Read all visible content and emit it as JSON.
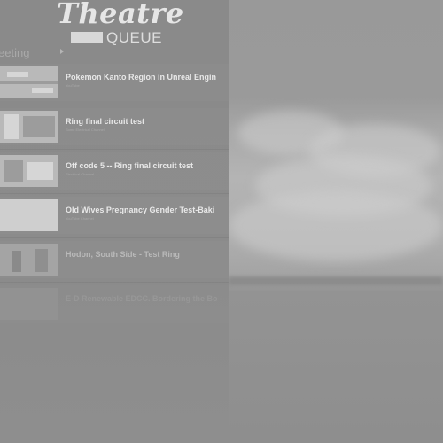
{
  "logo": {
    "script_text": "Theatre",
    "sub_text": "QUEUE"
  },
  "section": {
    "label": "eeting"
  },
  "queue": [
    {
      "title": "Pokemon Kanto Region in Unreal Engin",
      "subtitle": "YouTube"
    },
    {
      "title": "Ring final circuit test",
      "subtitle": "Some Electrical Channel"
    },
    {
      "title": "Off code 5 -- Ring final circuit test",
      "subtitle": "Electrical Channel"
    },
    {
      "title": "Old Wives Pregnancy Gender Test-Baki",
      "subtitle": "YouTube Channel"
    },
    {
      "title": "Hodon, South Side - Test Ring",
      "subtitle": ""
    },
    {
      "title": "E-D Renewable EDCC. Bordering the Bo",
      "subtitle": ""
    }
  ]
}
